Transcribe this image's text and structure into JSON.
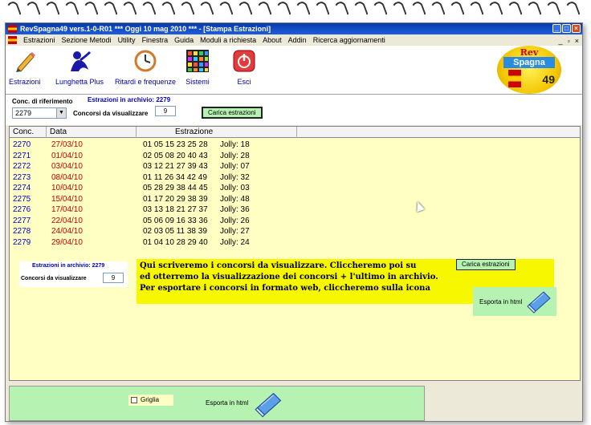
{
  "window": {
    "title": "RevSpagna49 vers.1-0-R01  ***  Oggi 10 mag 2010  ***  - [Stampa Estrazioni]"
  },
  "menu": [
    "Estrazioni",
    "Sezione Metodi",
    "Utility",
    "Finestra",
    "Guida",
    "Moduli a richiesta",
    "About",
    "Addin",
    "Ricerca aggiornamenti"
  ],
  "toolbar": {
    "estrazioni": "Estrazioni",
    "lunghetta": "Lunghetta Plus",
    "ritardi": "Ritardi e frequenze",
    "sistemi": "Sistemi",
    "esci": "Esci"
  },
  "logo": {
    "line1": "Rev",
    "line2": "Spagna",
    "line3": "49"
  },
  "params": {
    "conc_label": "Conc. di riferimento",
    "archive_label": "Estrazioni in archivio: 2279",
    "combo_value": "2279",
    "visual_label": "Concorsi da visualizzare",
    "visual_value": "9",
    "load_button": "Carica estrazioni"
  },
  "grid": {
    "headers": [
      "Conc.",
      "Data",
      "Estrazione"
    ],
    "rows": [
      {
        "conc": "2270",
        "data": "27/03/10",
        "nums": "01 05 15 23 25 28",
        "jolly": "Jolly: 18"
      },
      {
        "conc": "2271",
        "data": "01/04/10",
        "nums": "02 05 08 20 40 43",
        "jolly": "Jolly: 28"
      },
      {
        "conc": "2272",
        "data": "03/04/10",
        "nums": "03 12 21 27 39 43",
        "jolly": "Jolly: 07"
      },
      {
        "conc": "2273",
        "data": "08/04/10",
        "nums": "01 11 26 34 42 49",
        "jolly": "Jolly: 32"
      },
      {
        "conc": "2274",
        "data": "10/04/10",
        "nums": "05 28 29 38 44 45",
        "jolly": "Jolly: 03"
      },
      {
        "conc": "2275",
        "data": "15/04/10",
        "nums": "01 17 20 29 38 39",
        "jolly": "Jolly: 48"
      },
      {
        "conc": "2276",
        "data": "17/04/10",
        "nums": "03 13 18 21 27 37",
        "jolly": "Jolly: 36"
      },
      {
        "conc": "2277",
        "data": "22/04/10",
        "nums": "05 06 09 16 33 36",
        "jolly": "Jolly: 26"
      },
      {
        "conc": "2278",
        "data": "24/04/10",
        "nums": "02 03 05 11 38 39",
        "jolly": "Jolly: 27"
      },
      {
        "conc": "2279",
        "data": "29/04/10",
        "nums": "01 04 10 28 29 40",
        "jolly": "Jolly: 24"
      }
    ]
  },
  "inner_panel": {
    "archive_label": "Estrazioni in archivio: 2279",
    "visual_label": "Concorsi da visualizzare",
    "visual_value": "9",
    "load_button": "Carica estrazioni"
  },
  "tutorial": {
    "line1": "Qui scriveremo i concorsi da visualizzare. Cliccheremo poi su",
    "line2": "ed otterremo la visualizzazione dei concorsi + l'ultimo in archivio.",
    "line3": "Per esportare i concorsi in formato web, cliccheremo sulla icona"
  },
  "export": {
    "label": "Esporta in html"
  },
  "bottom": {
    "griglia_label": "Griglia",
    "export_label": "Esporta in html"
  }
}
